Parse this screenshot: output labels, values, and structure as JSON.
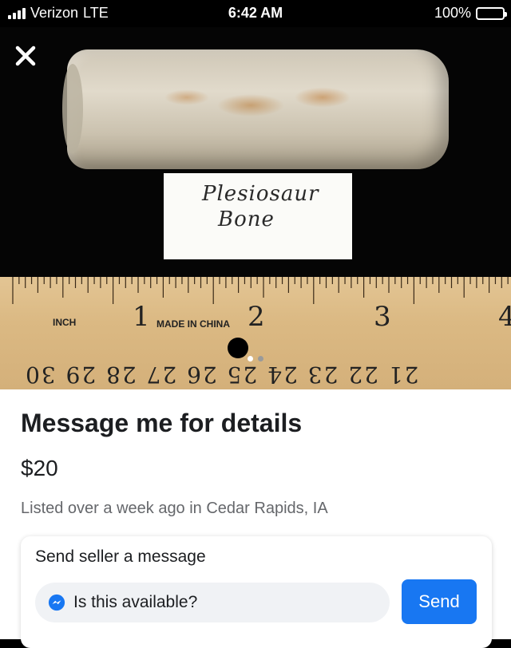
{
  "status_bar": {
    "carrier": "Verizon",
    "network": "LTE",
    "time": "6:42 AM",
    "battery_percent": "100%",
    "battery_level": 1.0
  },
  "photo": {
    "close_icon": "close-icon",
    "label_line1": "Plesiosaur",
    "label_line2": "Bone",
    "ruler_inch": "INCH",
    "ruler_made": "MADE IN CHINA",
    "ruler_numbers": [
      "1",
      "2",
      "3",
      "4"
    ],
    "ruler_cm": "21 22 23 24 25 26 27 28 29 30",
    "page_dots": 2,
    "active_dot": 0
  },
  "listing": {
    "title": "Message me for details",
    "price": "$20",
    "meta": "Listed over a week ago in Cedar Rapids, IA"
  },
  "message_card": {
    "heading": "Send seller a message",
    "input_value": "Is this available?",
    "messenger_icon": "messenger-icon",
    "send_label": "Send"
  },
  "colors": {
    "accent": "#1877f2",
    "text": "#1c1e21",
    "muted": "#65676b"
  }
}
